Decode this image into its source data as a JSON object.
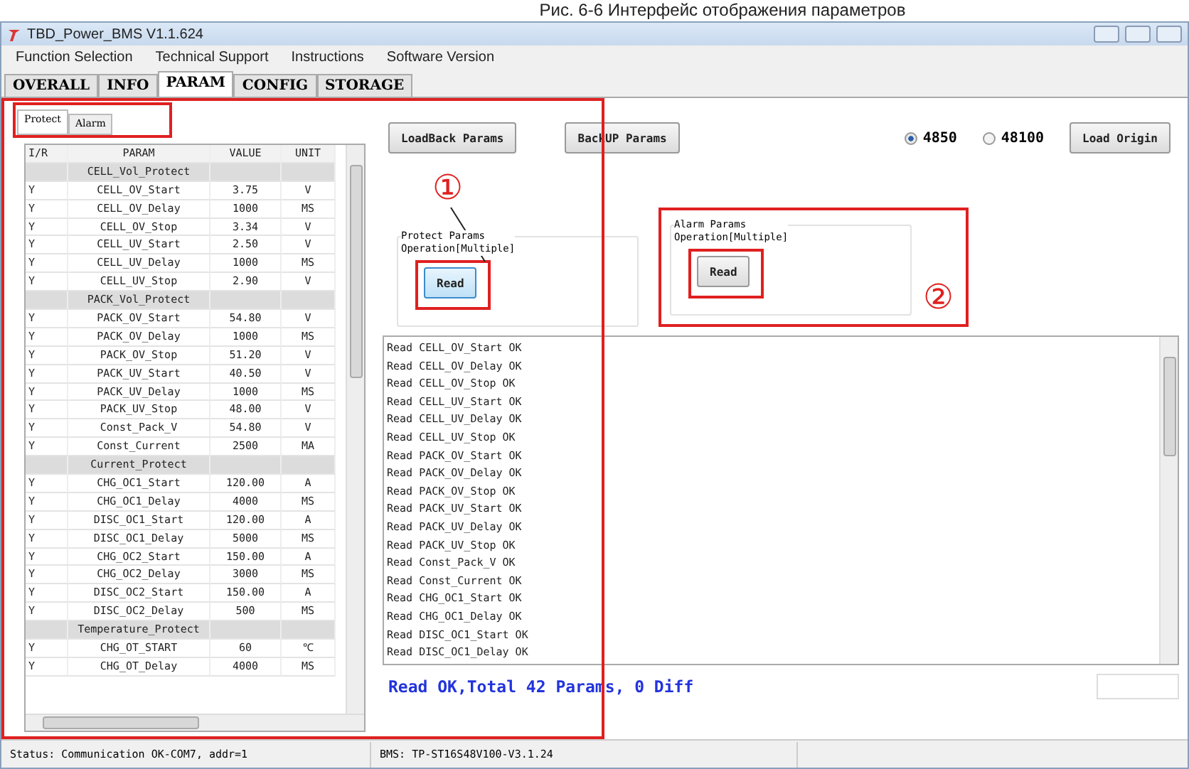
{
  "caption": "Рис. 6-6 Интерфейс отображения параметров",
  "window": {
    "title": "TBD_Power_BMS V1.1.624"
  },
  "menu": [
    "Function Selection",
    "Technical Support",
    "Instructions",
    "Software Version"
  ],
  "tabs": [
    {
      "label": "OVERALL",
      "selected": false
    },
    {
      "label": "INFO",
      "selected": false
    },
    {
      "label": "PARAM",
      "selected": true
    },
    {
      "label": "CONFIG",
      "selected": false
    },
    {
      "label": "STORAGE",
      "selected": false
    }
  ],
  "sub_tabs": [
    {
      "label": "Protect",
      "selected": true
    },
    {
      "label": "Alarm",
      "selected": false
    }
  ],
  "table": {
    "columns": [
      "I/R",
      "PARAM",
      "VALUE",
      "UNIT"
    ],
    "rows": [
      {
        "kind": "group",
        "param": "CELL_Vol_Protect"
      },
      {
        "kind": "data",
        "ir": "Y",
        "param": "CELL_OV_Start",
        "value": "3.75",
        "unit": "V"
      },
      {
        "kind": "data",
        "ir": "Y",
        "param": "CELL_OV_Delay",
        "value": "1000",
        "unit": "MS"
      },
      {
        "kind": "data",
        "ir": "Y",
        "param": "CELL_OV_Stop",
        "value": "3.34",
        "unit": "V"
      },
      {
        "kind": "data",
        "ir": "Y",
        "param": "CELL_UV_Start",
        "value": "2.50",
        "unit": "V"
      },
      {
        "kind": "data",
        "ir": "Y",
        "param": "CELL_UV_Delay",
        "value": "1000",
        "unit": "MS"
      },
      {
        "kind": "data",
        "ir": "Y",
        "param": "CELL_UV_Stop",
        "value": "2.90",
        "unit": "V"
      },
      {
        "kind": "group",
        "param": "PACK_Vol_Protect"
      },
      {
        "kind": "data",
        "ir": "Y",
        "param": "PACK_OV_Start",
        "value": "54.80",
        "unit": "V"
      },
      {
        "kind": "data",
        "ir": "Y",
        "param": "PACK_OV_Delay",
        "value": "1000",
        "unit": "MS"
      },
      {
        "kind": "data",
        "ir": "Y",
        "param": "PACK_OV_Stop",
        "value": "51.20",
        "unit": "V"
      },
      {
        "kind": "data",
        "ir": "Y",
        "param": "PACK_UV_Start",
        "value": "40.50",
        "unit": "V"
      },
      {
        "kind": "data",
        "ir": "Y",
        "param": "PACK_UV_Delay",
        "value": "1000",
        "unit": "MS"
      },
      {
        "kind": "data",
        "ir": "Y",
        "param": "PACK_UV_Stop",
        "value": "48.00",
        "unit": "V"
      },
      {
        "kind": "data",
        "ir": "Y",
        "param": "Const_Pack_V",
        "value": "54.80",
        "unit": "V"
      },
      {
        "kind": "data",
        "ir": "Y",
        "param": "Const_Current",
        "value": "2500",
        "unit": "MA"
      },
      {
        "kind": "group",
        "param": "Current_Protect"
      },
      {
        "kind": "data",
        "ir": "Y",
        "param": "CHG_OC1_Start",
        "value": "120.00",
        "unit": "A"
      },
      {
        "kind": "data",
        "ir": "Y",
        "param": "CHG_OC1_Delay",
        "value": "4000",
        "unit": "MS"
      },
      {
        "kind": "data",
        "ir": "Y",
        "param": "DISC_OC1_Start",
        "value": "120.00",
        "unit": "A"
      },
      {
        "kind": "data",
        "ir": "Y",
        "param": "DISC_OC1_Delay",
        "value": "5000",
        "unit": "MS"
      },
      {
        "kind": "data",
        "ir": "Y",
        "param": "CHG_OC2_Start",
        "value": "150.00",
        "unit": "A"
      },
      {
        "kind": "data",
        "ir": "Y",
        "param": "CHG_OC2_Delay",
        "value": "3000",
        "unit": "MS"
      },
      {
        "kind": "data",
        "ir": "Y",
        "param": "DISC_OC2_Start",
        "value": "150.00",
        "unit": "A"
      },
      {
        "kind": "data",
        "ir": "Y",
        "param": "DISC_OC2_Delay",
        "value": "500",
        "unit": "MS"
      },
      {
        "kind": "group",
        "param": "Temperature_Protect"
      },
      {
        "kind": "data",
        "ir": "Y",
        "param": "CHG_OT_START",
        "value": "60",
        "unit": "℃"
      },
      {
        "kind": "data",
        "ir": "Y",
        "param": "CHG_OT_Delay",
        "value": "4000",
        "unit": "MS"
      }
    ]
  },
  "toolbar": {
    "loadback": "LoadBack Params",
    "backup": "BackUP Params",
    "radios": [
      {
        "label": "4850",
        "selected": true
      },
      {
        "label": "48100",
        "selected": false
      }
    ],
    "load_origin": "Load Origin"
  },
  "groups": [
    {
      "title": "Protect Params\nOperation[Multiple]",
      "button": "Read",
      "focused": true
    },
    {
      "title": "Alarm Params\nOperation[Multiple]",
      "button": "Read",
      "focused": false
    }
  ],
  "log": [
    "Read CELL_OV_Start OK",
    "Read CELL_OV_Delay OK",
    "Read CELL_OV_Stop OK",
    "Read CELL_UV_Start OK",
    "Read CELL_UV_Delay OK",
    "Read CELL_UV_Stop OK",
    "Read PACK_OV_Start OK",
    "Read PACK_OV_Delay OK",
    "Read PACK_OV_Stop OK",
    "Read PACK_UV_Start OK",
    "Read PACK_UV_Delay OK",
    "Read PACK_UV_Stop OK",
    "Read Const_Pack_V OK",
    "Read Const_Current OK",
    "Read CHG_OC1_Start OK",
    "Read CHG_OC1_Delay OK",
    "Read DISC_OC1_Start OK",
    "Read DISC_OC1_Delay OK"
  ],
  "result": "Read OK,Total 42 Params, 0 Diff",
  "status_bar": [
    "Status: Communication OK-COM7, addr=1",
    "BMS: TP-ST16S48V100-V3.1.24"
  ],
  "annotations": [
    "①",
    "②"
  ]
}
